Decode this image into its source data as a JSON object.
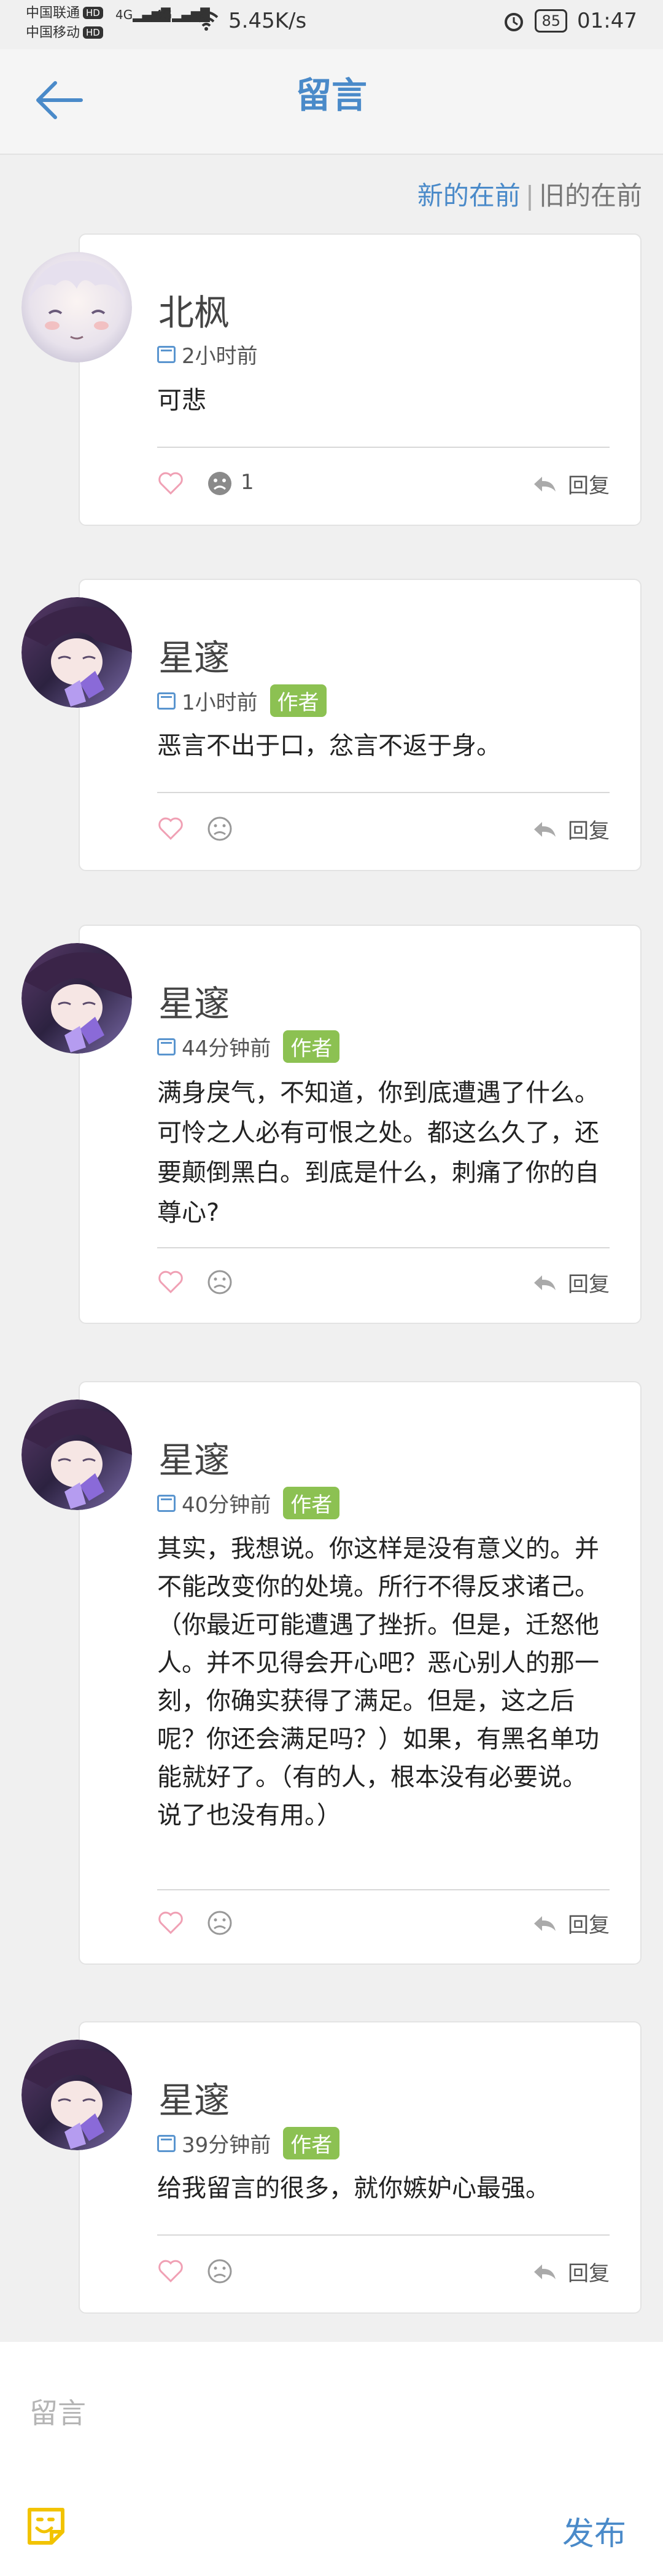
{
  "status_bar": {
    "carrier1": "中国联通",
    "carrier2": "中国移动",
    "hd": "HD",
    "signal1": "4G",
    "signal2": "4G",
    "speed": "5.45K/s",
    "battery": "85",
    "time": "01:47",
    "icons": [
      "signal-icon",
      "wifi-icon",
      "alarm-icon",
      "battery-icon"
    ]
  },
  "header": {
    "title": "留言",
    "back_icon": "arrow-left-icon"
  },
  "sort": {
    "newest": "新的在前",
    "separator": "|",
    "oldest": "旧的在前"
  },
  "comments": [
    {
      "name": "北枫",
      "time": "2小时前",
      "badge": "",
      "text": "可悲",
      "face_count": "1",
      "reply": "回复"
    },
    {
      "name": "星邃",
      "time": "1小时前",
      "badge": "作者",
      "text": "恶言不出于口，忿言不返于身。",
      "face_count": "",
      "reply": "回复"
    },
    {
      "name": "星邃",
      "time": "44分钟前",
      "badge": "作者",
      "text": "满身戾气，不知道，你到底遭遇了什么。可怜之人必有可恨之处。都这么久了，还要颠倒黑白。到底是什么，刺痛了你的自尊心?",
      "face_count": "",
      "reply": "回复"
    },
    {
      "name": "星邃",
      "time": "40分钟前",
      "badge": "作者",
      "text": "其实，我想说。你这样是没有意义的。并不能改变你的处境。所行不得反求诸己。（你最近可能遭遇了挫折。但是，迁怒他人。并不见得会开心吧？恶心别人的那一刻，你确实获得了满足。但是，这之后呢？你还会满足吗？）如果，有黑名单功能就好了。（有的人，根本没有必要说。说了也没有用。）",
      "face_count": "",
      "reply": "回复"
    },
    {
      "name": "星邃",
      "time": "39分钟前",
      "badge": "作者",
      "text": "给我留言的很多，就你嫉妒心最强。",
      "face_count": "",
      "reply": "回复"
    }
  ],
  "bottom": {
    "placeholder": "留言",
    "publish": "发布",
    "emoji_icon": "sticker-icon"
  },
  "colors": {
    "accent": "#4a8ac9",
    "badge": "#8cc152",
    "like": "#f0a0b4"
  }
}
